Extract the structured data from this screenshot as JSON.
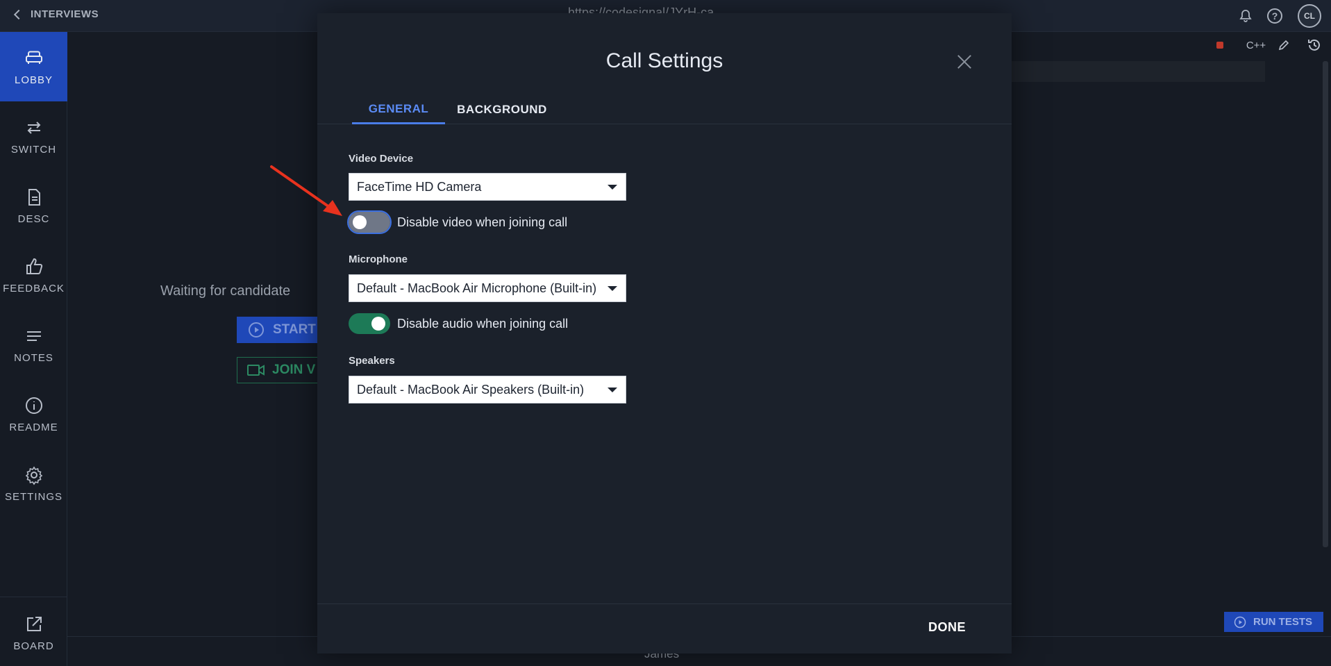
{
  "topbar": {
    "back_label": "INTERVIEWS",
    "url": "https://codesignal/JYrH-ca",
    "avatar_initials": "CL"
  },
  "nav": {
    "items": [
      {
        "label": "LOBBY",
        "icon": "couch-icon",
        "active": true
      },
      {
        "label": "SWITCH",
        "icon": "swap-arrows-icon"
      },
      {
        "label": "DESC",
        "icon": "document-icon"
      },
      {
        "label": "FEEDBACK",
        "icon": "thumbs-up-icon"
      },
      {
        "label": "NOTES",
        "icon": "lines-icon"
      },
      {
        "label": "README",
        "icon": "info-icon"
      },
      {
        "label": "SETTINGS",
        "icon": "gear-icon"
      },
      {
        "label": "BOARD",
        "icon": "external-link-icon"
      }
    ]
  },
  "lobby": {
    "waiting_text": "Waiting for candidate",
    "start_label": "START",
    "join_label": "JOIN V"
  },
  "editor": {
    "language": "C++",
    "run_tests_label": "RUN TESTS",
    "participant_name": "James"
  },
  "modal": {
    "title": "Call Settings",
    "tabs": [
      "GENERAL",
      "BACKGROUND"
    ],
    "video": {
      "label": "Video Device",
      "selected": "FaceTime HD Camera",
      "toggle_label": "Disable video when joining call",
      "toggle_on": false
    },
    "microphone": {
      "label": "Microphone",
      "selected": "Default - MacBook Air Microphone (Built-in)",
      "toggle_label": "Disable audio when joining call",
      "toggle_on": true
    },
    "speakers": {
      "label": "Speakers",
      "selected": "Default - MacBook Air Speakers (Built-in)"
    },
    "done_label": "DONE"
  },
  "colors": {
    "accent": "#1f48b8",
    "tab_active": "#5b8bf5",
    "toggle_on": "#1d7a57",
    "annotation_arrow": "#e8321e"
  }
}
